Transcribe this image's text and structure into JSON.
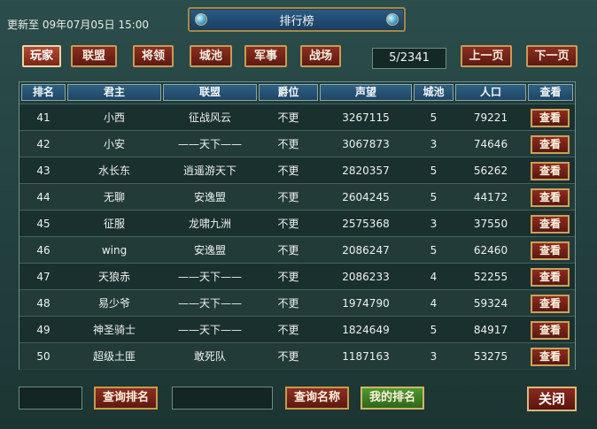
{
  "update_text": "更新至 09年07月05日 15:00",
  "window_title": "排行榜",
  "tabs": [
    "玩家",
    "联盟",
    "将领",
    "城池",
    "军事",
    "战场"
  ],
  "page_indicator": "5/2341",
  "nav": {
    "prev_label": "上一页",
    "next_label": "下一页"
  },
  "columns": [
    "排名",
    "君主",
    "联盟",
    "爵位",
    "声望",
    "城池",
    "人口",
    "查看"
  ],
  "rows": [
    {
      "rank": "41",
      "lord": "小西",
      "alliance": "征战风云",
      "title": "不更",
      "prestige": "3267115",
      "cities": "5",
      "population": "79221",
      "view": "查看"
    },
    {
      "rank": "42",
      "lord": "小安",
      "alliance": "——天下——",
      "title": "不更",
      "prestige": "3067873",
      "cities": "3",
      "population": "74646",
      "view": "查看"
    },
    {
      "rank": "43",
      "lord": "水长东",
      "alliance": "逍遥游天下",
      "title": "不更",
      "prestige": "2820357",
      "cities": "5",
      "population": "56262",
      "view": "查看"
    },
    {
      "rank": "44",
      "lord": "无聊",
      "alliance": "安逸盟",
      "title": "不更",
      "prestige": "2604245",
      "cities": "5",
      "population": "44172",
      "view": "查看"
    },
    {
      "rank": "45",
      "lord": "征服",
      "alliance": "龙啸九洲",
      "title": "不更",
      "prestige": "2575368",
      "cities": "3",
      "population": "37550",
      "view": "查看"
    },
    {
      "rank": "46",
      "lord": "wing",
      "alliance": "安逸盟",
      "title": "不更",
      "prestige": "2086247",
      "cities": "5",
      "population": "62460",
      "view": "查看"
    },
    {
      "rank": "47",
      "lord": "天狼赤",
      "alliance": "——天下——",
      "title": "不更",
      "prestige": "2086233",
      "cities": "4",
      "population": "52255",
      "view": "查看"
    },
    {
      "rank": "48",
      "lord": "易少爷",
      "alliance": "——天下——",
      "title": "不更",
      "prestige": "1974790",
      "cities": "4",
      "population": "59324",
      "view": "查看"
    },
    {
      "rank": "49",
      "lord": "神圣骑士",
      "alliance": "——天下——",
      "title": "不更",
      "prestige": "1824649",
      "cities": "5",
      "population": "84917",
      "view": "查看"
    },
    {
      "rank": "50",
      "lord": "超级土匪",
      "alliance": "敢死队",
      "title": "不更",
      "prestige": "1187163",
      "cities": "3",
      "population": "53275",
      "view": "查看"
    }
  ],
  "bottom": {
    "query_rank_label": "查询排名",
    "query_name_label": "查询名称",
    "my_rank_label": "我的排名",
    "close_label": "关闭"
  }
}
